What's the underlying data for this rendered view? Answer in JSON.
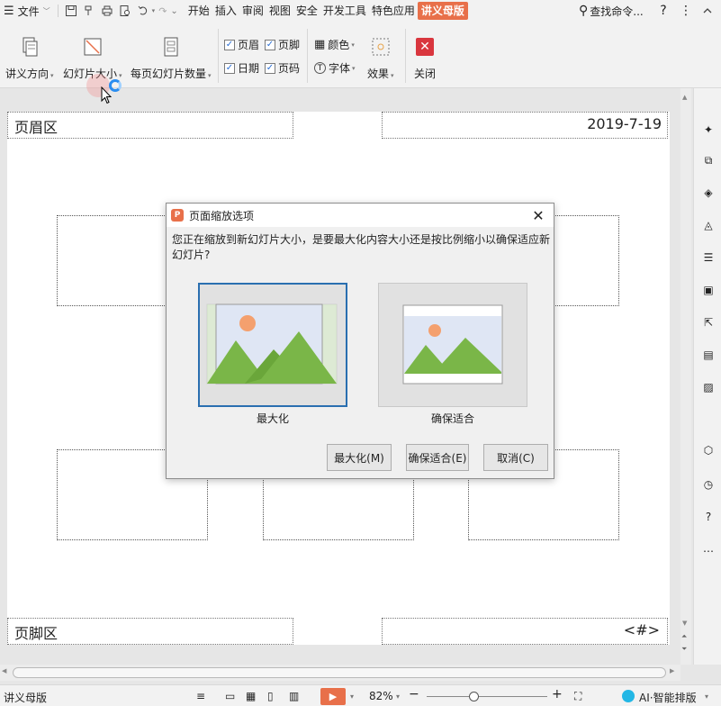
{
  "menubar": {
    "file_label": "文件",
    "tabs": [
      "开始",
      "插入",
      "审阅",
      "视图",
      "安全",
      "开发工具",
      "特色应用",
      "讲义母版"
    ],
    "search_label": "查找命令...",
    "help": "?"
  },
  "ribbon": {
    "orientation_label": "讲义方向",
    "slide_size_label": "幻灯片大小",
    "per_page_label": "每页幻灯片数量",
    "checks": [
      {
        "label": "页眉",
        "checked": true
      },
      {
        "label": "页脚",
        "checked": true
      },
      {
        "label": "日期",
        "checked": true
      },
      {
        "label": "页码",
        "checked": true
      }
    ],
    "color_label": "颜色",
    "font_label": "字体",
    "effect_label": "效果",
    "close_label": "关闭"
  },
  "page": {
    "header_text": "页眉区",
    "date_text": "2019-7-19",
    "footer_text": "页脚区",
    "page_number_text": "<#>"
  },
  "dialog": {
    "title": "页面缩放选项",
    "message": "您正在缩放到新幻灯片大小，是要最大化内容大小还是按比例缩小以确保适应新幻灯片?",
    "option_maximize": "最大化",
    "option_fit": "确保适合",
    "btn_maximize": "最大化(M)",
    "btn_fit": "确保适合(E)",
    "btn_cancel": "取消(C)"
  },
  "status": {
    "mode": "讲义母版",
    "zoom": "82%",
    "ai_label": "AI·智能排版"
  },
  "colors": {
    "accent": "#e8704a",
    "selection": "#2a6fb0",
    "close_red": "#d9363e",
    "mountain": "#7ab648",
    "sun": "#f4a06e",
    "sky": "#dfe6f4"
  }
}
